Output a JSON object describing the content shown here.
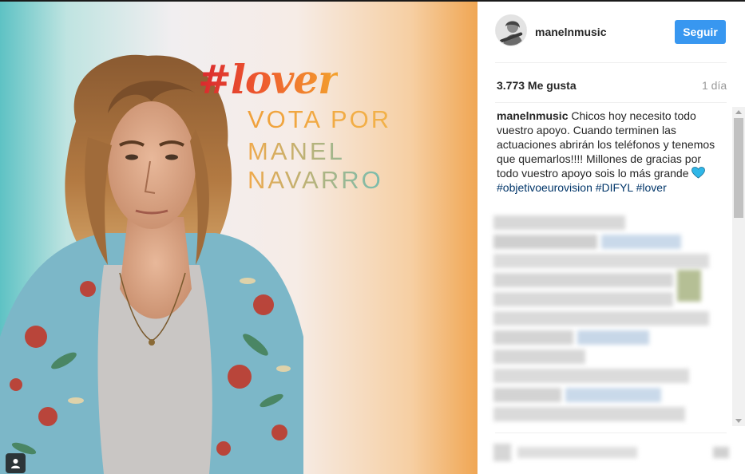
{
  "post": {
    "image": {
      "hashtag_title": "#lover",
      "line1": "VOTA POR",
      "line2": "MANEL NAVARRO",
      "tag_icon": "user-icon"
    },
    "header": {
      "username": "manelnmusic",
      "follow_label": "Seguir",
      "follow_color": "#3897f0"
    },
    "likes": "3.773 Me gusta",
    "time_ago": "1 día",
    "caption": {
      "author": "manelnmusic",
      "text": "Chicos hoy necesito todo vuestro apoyo. Cuando terminen las actuaciones abrirán los teléfonos y tenemos que quemarlos!!!! Millones de gracias por todo vuestro apoyo sois lo más grande",
      "emoji": "heart-icon",
      "hashtags": [
        "#objetivoeurovision",
        "#DIFYL",
        "#lover"
      ]
    },
    "colors": {
      "hashtag": "#003569",
      "heart": "#2fb7e8",
      "time": "#999999"
    }
  }
}
